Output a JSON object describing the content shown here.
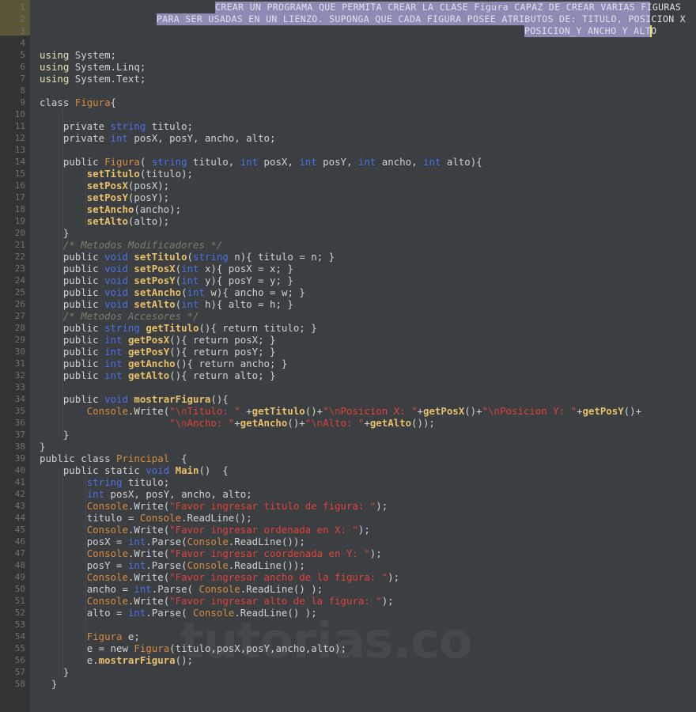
{
  "editor": {
    "theme_name": "darcula",
    "background_color": "#3c3f41",
    "gutter_color": "#313335",
    "gutter_highlight_color": "#5a5637",
    "selection_color": "#8b8bb5",
    "caret_color": "#e8e16a",
    "font_size": "12px",
    "watermark": "tutorias.co",
    "language": "C#"
  },
  "colors": {
    "keyword": "#cc7832",
    "using_keyword": "#e8e2b7",
    "primitive_type": "#4a6fe8",
    "class_name": "#d88a3c",
    "method_name": "#e8bf6a",
    "string": "#e2403a",
    "escape": "#c1413c",
    "comment": "#72806b",
    "default_text": "#a9b7c6",
    "line_number": "#6e7174"
  },
  "gutter": {
    "first_line": 1,
    "last_line": 58,
    "highlighted_lines": [
      1,
      2,
      3
    ],
    "line_numbers": [
      1,
      2,
      3,
      4,
      5,
      6,
      7,
      8,
      9,
      10,
      11,
      12,
      13,
      14,
      15,
      16,
      17,
      18,
      19,
      20,
      21,
      22,
      23,
      24,
      25,
      26,
      27,
      28,
      29,
      30,
      31,
      32,
      33,
      34,
      35,
      36,
      37,
      38,
      39,
      40,
      41,
      42,
      43,
      44,
      45,
      46,
      47,
      48,
      49,
      50,
      51,
      52,
      53,
      54,
      55,
      56,
      57,
      58
    ]
  },
  "header_comment": {
    "selected": true,
    "lines": [
      "CREAR UN PROGRAMA QUE PERMITA CREAR LA CLASE Figura CAPAZ DE CREAR VARIAS FIGURAS",
      "PARA SER USADAS EN UN LIENZO. SUPONGA QUE CADA FIGURA POSEE ATRIBUTOS DE: TITULO, POSICION X",
      "POSICION_Y ANCHO Y ALTO"
    ]
  },
  "code_lines": [
    {
      "n": 1,
      "text": ""
    },
    {
      "n": 2,
      "text": ""
    },
    {
      "n": 3,
      "text": ""
    },
    {
      "n": 4,
      "text": ""
    },
    {
      "n": 5,
      "text": "using System;"
    },
    {
      "n": 6,
      "text": "using System.Linq;"
    },
    {
      "n": 7,
      "text": "using System.Text;"
    },
    {
      "n": 8,
      "text": ""
    },
    {
      "n": 9,
      "text": "class Figura{"
    },
    {
      "n": 10,
      "text": ""
    },
    {
      "n": 11,
      "text": "    private string titulo;"
    },
    {
      "n": 12,
      "text": "    private int posX, posY, ancho, alto;"
    },
    {
      "n": 13,
      "text": ""
    },
    {
      "n": 14,
      "text": "    public Figura( string titulo, int posX, int posY, int ancho, int alto){"
    },
    {
      "n": 15,
      "text": "        setTitulo(titulo);"
    },
    {
      "n": 16,
      "text": "        setPosX(posX);"
    },
    {
      "n": 17,
      "text": "        setPosY(posY);"
    },
    {
      "n": 18,
      "text": "        setAncho(ancho);"
    },
    {
      "n": 19,
      "text": "        setAlto(alto);"
    },
    {
      "n": 20,
      "text": "    }"
    },
    {
      "n": 21,
      "text": "    /* Metodos Modificadores */"
    },
    {
      "n": 22,
      "text": "    public void setTitulo(string n){ titulo = n; }"
    },
    {
      "n": 23,
      "text": "    public void setPosX(int x){ posX = x; }"
    },
    {
      "n": 24,
      "text": "    public void setPosY(int y){ posY = y; }"
    },
    {
      "n": 25,
      "text": "    public void setAncho(int w){ ancho = w; }"
    },
    {
      "n": 26,
      "text": "    public void setAlto(int h){ alto = h; }"
    },
    {
      "n": 27,
      "text": "    /* Metodos Accesores */"
    },
    {
      "n": 28,
      "text": "    public string getTitulo(){ return titulo; }"
    },
    {
      "n": 29,
      "text": "    public int getPosX(){ return posX; }"
    },
    {
      "n": 30,
      "text": "    public int getPosY(){ return posY; }"
    },
    {
      "n": 31,
      "text": "    public int getAncho(){ return ancho; }"
    },
    {
      "n": 32,
      "text": "    public int getAlto(){ return alto; }"
    },
    {
      "n": 33,
      "text": ""
    },
    {
      "n": 34,
      "text": "    public void mostrarFigura(){"
    },
    {
      "n": 35,
      "text": "        Console.Write(\"\\nTitulo: \" +getTitulo()+\"\\nPosicion X: \"+getPosX()+\"\\nPosicion Y: \"+getPosY()+"
    },
    {
      "n": 36,
      "text": "                      \"\\nAncho: \"+getAncho()+\"\\nAlto: \"+getAlto());"
    },
    {
      "n": 37,
      "text": "    }"
    },
    {
      "n": 38,
      "text": "}"
    },
    {
      "n": 39,
      "text": "public class Principal  {"
    },
    {
      "n": 40,
      "text": "    public static void Main()  {"
    },
    {
      "n": 41,
      "text": "        string titulo;"
    },
    {
      "n": 42,
      "text": "        int posX, posY, ancho, alto;"
    },
    {
      "n": 43,
      "text": "        Console.Write(\"Favor ingresar titulo de figura: \");"
    },
    {
      "n": 44,
      "text": "        titulo = Console.ReadLine();"
    },
    {
      "n": 45,
      "text": "        Console.Write(\"Favor ingresar ordenada en X: \");"
    },
    {
      "n": 46,
      "text": "        posX = int.Parse(Console.ReadLine());"
    },
    {
      "n": 47,
      "text": "        Console.Write(\"Favor ingresar coordenada en Y: \");"
    },
    {
      "n": 48,
      "text": "        posY = int.Parse(Console.ReadLine());"
    },
    {
      "n": 49,
      "text": "        Console.Write(\"Favor ingresar ancho de la figura: \");"
    },
    {
      "n": 50,
      "text": "        ancho = int.Parse( Console.ReadLine() );"
    },
    {
      "n": 51,
      "text": "        Console.Write(\"Favor ingresar alto de la figura: \");"
    },
    {
      "n": 52,
      "text": "        alto = int.Parse( Console.ReadLine() );"
    },
    {
      "n": 53,
      "text": ""
    },
    {
      "n": 54,
      "text": "        Figura e;"
    },
    {
      "n": 55,
      "text": "        e = new Figura(titulo,posX,posY,ancho,alto);"
    },
    {
      "n": 56,
      "text": "        e.mostrarFigura();"
    },
    {
      "n": 57,
      "text": "    }"
    },
    {
      "n": 58,
      "text": "  }"
    }
  ]
}
